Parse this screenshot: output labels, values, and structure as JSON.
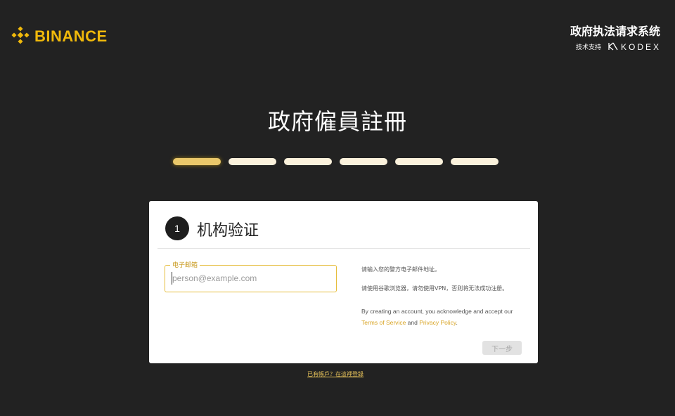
{
  "header": {
    "brand": "BINANCE",
    "system_title": "政府执法请求系统",
    "support_label": "技术支持",
    "support_brand": "KODEX",
    "brand_color": "#F0B90B"
  },
  "main": {
    "title": "政府僱員註冊",
    "progress": {
      "total_steps": 6,
      "current_step": 1
    }
  },
  "card": {
    "step_number": "1",
    "title": "机构验证",
    "email": {
      "label": "电子邮箱",
      "placeholder": "person@example.com",
      "value": ""
    },
    "help": {
      "line1": "请输入您的警方电子邮件地址。",
      "line2": "请使用谷歌浏览器，请勿使用VPN，否则将无法成功注册。",
      "consent_prefix": "By creating an account, you acknowledge and accept our",
      "terms_link": "Terms of Service",
      "and_text": "and",
      "privacy_link": "Privacy Policy",
      "suffix": "."
    },
    "next_button": "下一步"
  },
  "footer": {
    "login_link": "已有帳戶？在這裡登錄"
  }
}
